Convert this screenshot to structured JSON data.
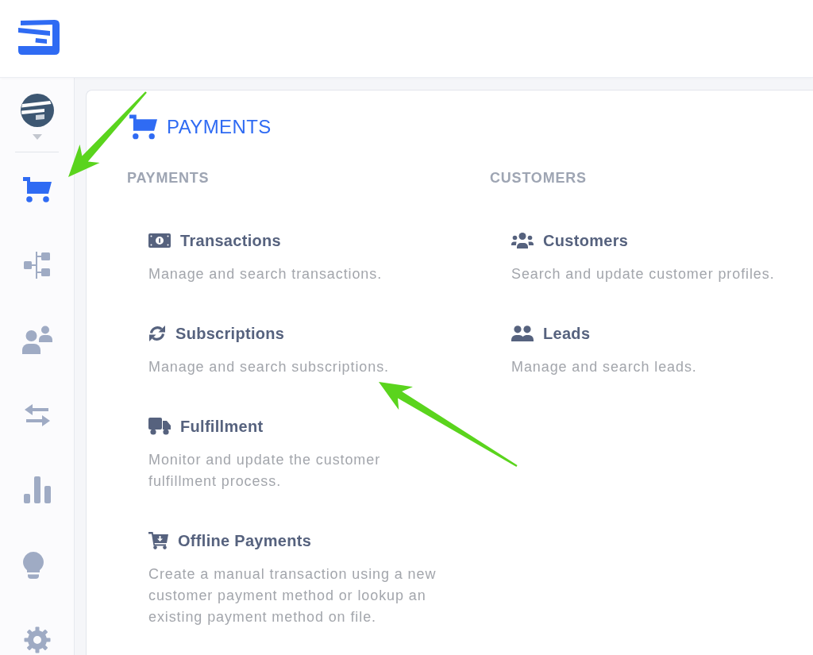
{
  "sidebar": {
    "items": [
      {
        "selected": true
      },
      {
        "selected": false
      },
      {
        "selected": false
      },
      {
        "selected": false
      },
      {
        "selected": false
      },
      {
        "selected": false
      },
      {
        "selected": false
      }
    ]
  },
  "page": {
    "title": "PAYMENTS"
  },
  "sections": [
    {
      "heading": "PAYMENTS",
      "items": [
        {
          "title": "Transactions",
          "description": "Manage and search transactions."
        },
        {
          "title": "Subscriptions",
          "description": "Manage and search subscriptions."
        },
        {
          "title": "Fulfillment",
          "description": "Monitor and update the customer fulfillment process."
        },
        {
          "title": "Offline Payments",
          "description": "Create a manual transaction using a new customer payment method or lookup an existing payment method on file."
        }
      ]
    },
    {
      "heading": "CUSTOMERS",
      "items": [
        {
          "title": "Customers",
          "description": "Search and update customer profiles."
        },
        {
          "title": "Leads",
          "description": "Manage and search leads."
        }
      ]
    }
  ]
}
